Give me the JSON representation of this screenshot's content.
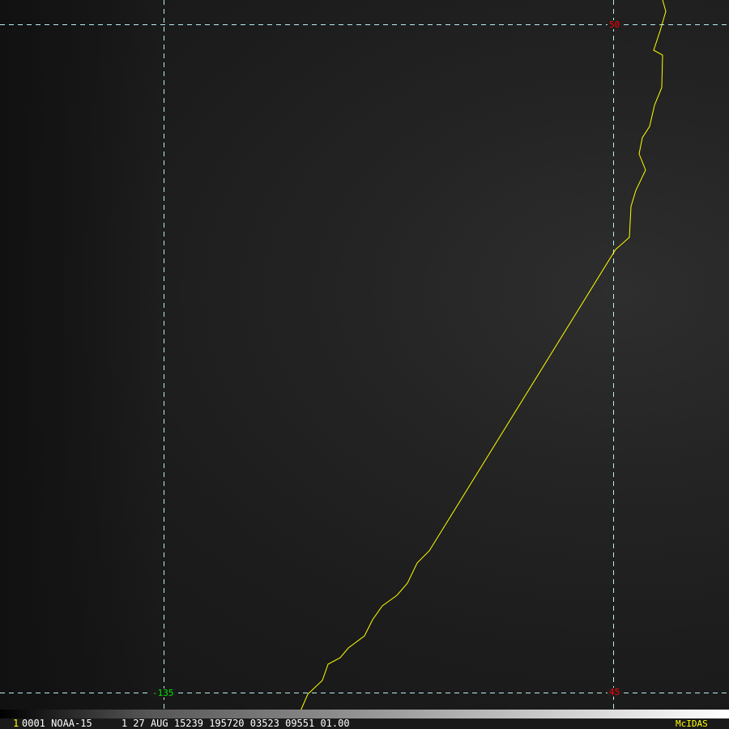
{
  "grid_labels": {
    "lat_top": "50",
    "lat_bottom": "45",
    "lon_left": "-135"
  },
  "info_bar": {
    "frame": "1",
    "text": "0001 NOAA-15     1 27 AUG 15239 195720 03523 09551 01.00",
    "brand": "McIDAS"
  },
  "colors": {
    "coastline": "#ffff00",
    "grid": "#9fe8ef",
    "lat_label": "#ff0000",
    "lon_label": "#00e000",
    "brand": "#ffff00"
  }
}
